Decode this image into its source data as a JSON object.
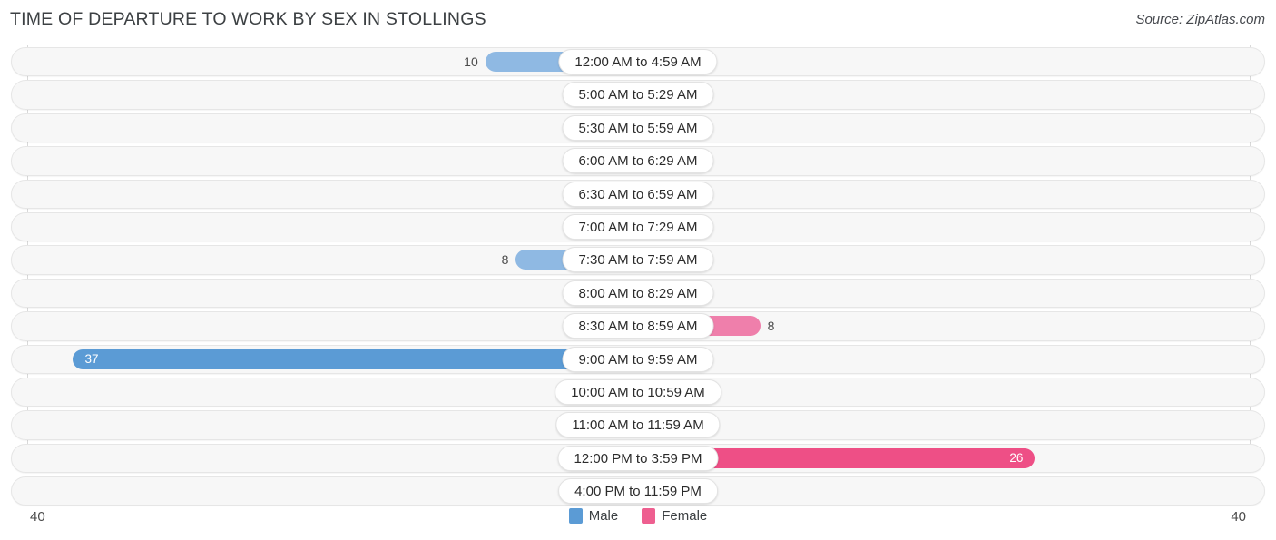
{
  "header": {
    "title": "TIME OF DEPARTURE TO WORK BY SEX IN STOLLINGS",
    "source": "Source: ZipAtlas.com"
  },
  "legend": {
    "male_label": "Male",
    "female_label": "Female",
    "male_color": "#5b9bd5",
    "female_color": "#ee5f90"
  },
  "axis": {
    "left_max_label": "40",
    "right_max_label": "40",
    "max": 40
  },
  "colors": {
    "male_strong": "#5b9bd5",
    "male_light": "#a8c7e8",
    "female_strong": "#ee4f86",
    "female_mid": "#ef7fab",
    "female_light": "#f5a9c4",
    "track_fill": "#f7f7f7",
    "track_border": "#e6e6e6",
    "pill_bg": "#ffffff",
    "value_text": "#4a4a4a",
    "title_text": "#3c4043"
  },
  "chart_data": {
    "type": "bar",
    "subtype": "diverging-bidirectional-bar",
    "title": "TIME OF DEPARTURE TO WORK BY SEX IN STOLLINGS",
    "xlabel": "",
    "ylabel": "",
    "xlim": [
      40,
      40
    ],
    "grid": false,
    "legend_position": "bottom-center",
    "categories": [
      "12:00 AM to 4:59 AM",
      "5:00 AM to 5:29 AM",
      "5:30 AM to 5:59 AM",
      "6:00 AM to 6:29 AM",
      "6:30 AM to 6:59 AM",
      "7:00 AM to 7:29 AM",
      "7:30 AM to 7:59 AM",
      "8:00 AM to 8:29 AM",
      "8:30 AM to 8:59 AM",
      "9:00 AM to 9:59 AM",
      "10:00 AM to 10:59 AM",
      "11:00 AM to 11:59 AM",
      "12:00 PM to 3:59 PM",
      "4:00 PM to 11:59 PM"
    ],
    "series": [
      {
        "name": "Male",
        "color": "#5b9bd5",
        "direction": "left",
        "values": [
          10,
          0,
          0,
          0,
          0,
          0,
          8,
          0,
          0,
          37,
          0,
          0,
          0,
          0
        ]
      },
      {
        "name": "Female",
        "color": "#ee5f90",
        "direction": "right",
        "values": [
          0,
          0,
          0,
          0,
          0,
          0,
          0,
          0,
          8,
          0,
          0,
          0,
          26,
          0
        ]
      }
    ]
  },
  "rows": [
    {
      "label": "12:00 AM to 4:59 AM",
      "male": 10,
      "female": 0,
      "male_text": "10",
      "female_text": "0"
    },
    {
      "label": "5:00 AM to 5:29 AM",
      "male": 0,
      "female": 0,
      "male_text": "0",
      "female_text": "0"
    },
    {
      "label": "5:30 AM to 5:59 AM",
      "male": 0,
      "female": 0,
      "male_text": "0",
      "female_text": "0"
    },
    {
      "label": "6:00 AM to 6:29 AM",
      "male": 0,
      "female": 0,
      "male_text": "0",
      "female_text": "0"
    },
    {
      "label": "6:30 AM to 6:59 AM",
      "male": 0,
      "female": 0,
      "male_text": "0",
      "female_text": "0"
    },
    {
      "label": "7:00 AM to 7:29 AM",
      "male": 0,
      "female": 0,
      "male_text": "0",
      "female_text": "0"
    },
    {
      "label": "7:30 AM to 7:59 AM",
      "male": 8,
      "female": 0,
      "male_text": "8",
      "female_text": "0"
    },
    {
      "label": "8:00 AM to 8:29 AM",
      "male": 0,
      "female": 0,
      "male_text": "0",
      "female_text": "0"
    },
    {
      "label": "8:30 AM to 8:59 AM",
      "male": 0,
      "female": 8,
      "male_text": "0",
      "female_text": "8"
    },
    {
      "label": "9:00 AM to 9:59 AM",
      "male": 37,
      "female": 0,
      "male_text": "37",
      "female_text": "0"
    },
    {
      "label": "10:00 AM to 10:59 AM",
      "male": 0,
      "female": 0,
      "male_text": "0",
      "female_text": "0"
    },
    {
      "label": "11:00 AM to 11:59 AM",
      "male": 0,
      "female": 0,
      "male_text": "0",
      "female_text": "0"
    },
    {
      "label": "12:00 PM to 3:59 PM",
      "male": 0,
      "female": 26,
      "male_text": "0",
      "female_text": "26"
    },
    {
      "label": "4:00 PM to 11:59 PM",
      "male": 0,
      "female": 0,
      "male_text": "0",
      "female_text": "0"
    }
  ]
}
